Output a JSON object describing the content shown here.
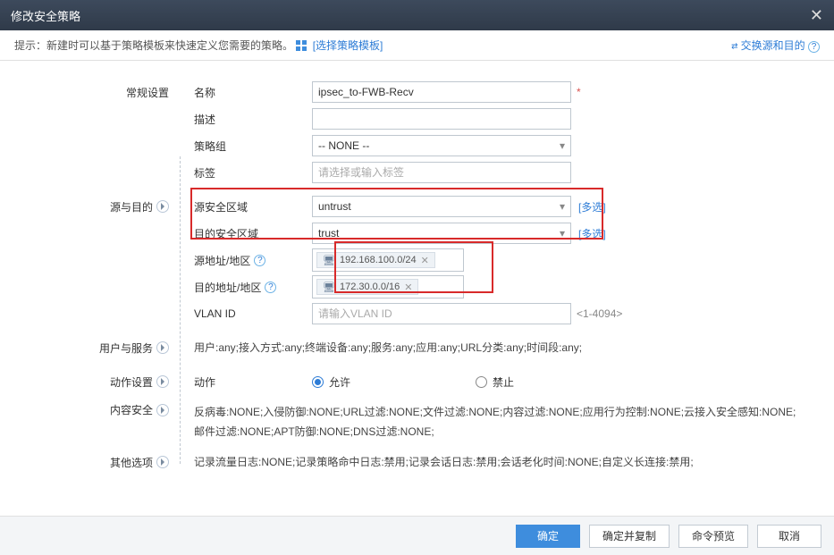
{
  "dialog": {
    "title": "修改安全策略"
  },
  "tip": {
    "text": "提示：新建时可以基于策略模板来快速定义您需要的策略。",
    "template_link": "[选择策略模板]",
    "swap_link": "交换源和目的"
  },
  "sections": {
    "general": {
      "label": "常规设置"
    },
    "srcdst": {
      "label": "源与目的"
    },
    "userservice": {
      "label": "用户与服务"
    },
    "action": {
      "label": "动作设置"
    },
    "contentsec": {
      "label": "内容安全"
    },
    "other": {
      "label": "其他选项"
    }
  },
  "fields": {
    "name": {
      "label": "名称",
      "value": "ipsec_to-FWB-Recv"
    },
    "desc": {
      "label": "描述",
      "value": ""
    },
    "group": {
      "label": "策略组",
      "value": "-- NONE --"
    },
    "tags": {
      "label": "标签",
      "placeholder": "请选择或输入标签"
    },
    "srczone": {
      "label": "源安全区域",
      "value": "untrust",
      "more": "[多选]"
    },
    "dstzone": {
      "label": "目的安全区域",
      "value": "trust",
      "more": "[多选]"
    },
    "srcaddr": {
      "label": "源地址/地区",
      "chip": "192.168.100.0/24"
    },
    "dstaddr": {
      "label": "目的地址/地区",
      "chip": "172.30.0.0/16"
    },
    "vlan": {
      "label": "VLAN ID",
      "placeholder": "请输入VLAN ID",
      "hint": "<1-4094>"
    }
  },
  "userservice_summary": "用户:any;接入方式:any;终端设备:any;服务:any;应用:any;URL分类:any;时间段:any;",
  "action": {
    "label": "动作",
    "allow": "允许",
    "deny": "禁止",
    "selected": "allow"
  },
  "contentsec_summary": "反病毒:NONE;入侵防御:NONE;URL过滤:NONE;文件过滤:NONE;内容过滤:NONE;应用行为控制:NONE;云接入安全感知:NONE;邮件过滤:NONE;APT防御:NONE;DNS过滤:NONE;",
  "other_summary": "记录流量日志:NONE;记录策略命中日志:禁用;记录会话日志:禁用;会话老化时间:NONE;自定义长连接:禁用;",
  "footer": {
    "ok": "确定",
    "ok_copy": "确定并复制",
    "preview": "命令预览",
    "cancel": "取消"
  }
}
